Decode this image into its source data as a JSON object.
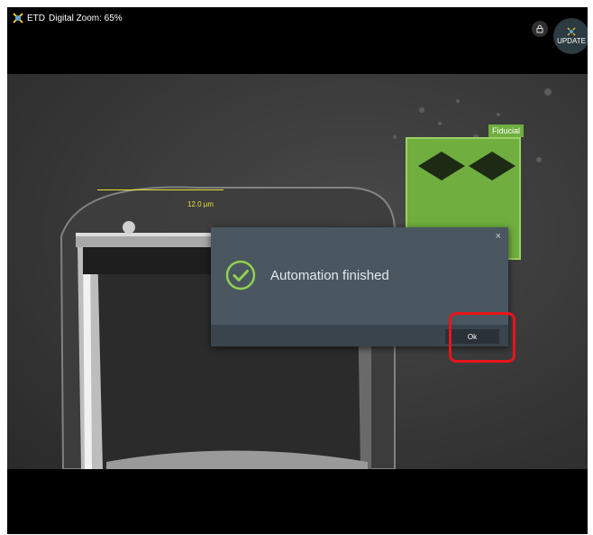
{
  "header": {
    "detector": "ETD",
    "zoom_text": "Digital Zoom: 65%",
    "update_label": "UPDATE"
  },
  "image": {
    "scale_bar_label": "12.0 µm",
    "fiducial_label": "Fiducial"
  },
  "dialog": {
    "message": "Automation finished",
    "close_glyph": "×",
    "ok_label": "Ok"
  },
  "colors": {
    "accent_green": "#6fae3f",
    "check_green": "#8fd14f",
    "highlight_red": "#e8141a",
    "scale_yellow": "#e6e13a"
  },
  "icons": {
    "detector": "detector-icon",
    "lock": "lock-icon",
    "update": "update-icon",
    "success": "check-circle-icon"
  }
}
